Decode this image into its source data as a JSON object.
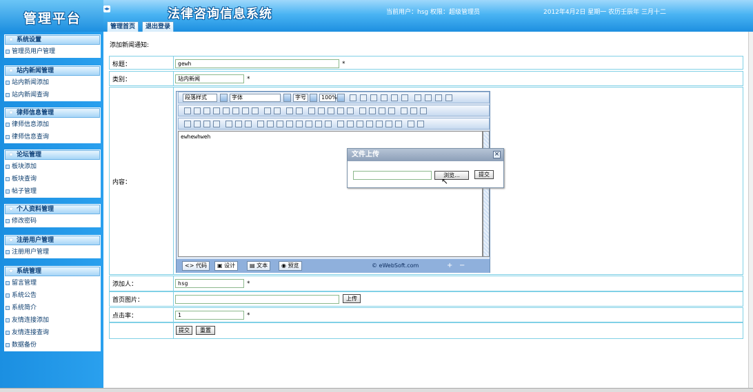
{
  "header": {
    "logo": "管理平台",
    "system_title": "法律咨询信息系统",
    "user_info": "当前用户：hsg 权限：超级管理员",
    "date_info": "2012年4月2日 星期一 农历壬辰年 三月十二",
    "toggle": "◂▸",
    "tabs": [
      {
        "label": "管理首页"
      },
      {
        "label": "退出登录"
      }
    ]
  },
  "sidebar": {
    "groups": [
      {
        "title": "系统设置",
        "items": [
          "管理员用户管理"
        ]
      },
      {
        "title": "站内新闻管理",
        "items": [
          "站内新闻添加",
          "站内新闻查询"
        ]
      },
      {
        "title": "律师信息管理",
        "items": [
          "律师信息添加",
          "律师信息查询"
        ]
      },
      {
        "title": "论坛管理",
        "items": [
          "板块添加",
          "板块查询",
          "帖子管理"
        ]
      },
      {
        "title": "个人资料管理",
        "items": [
          "修改密码"
        ]
      },
      {
        "title": "注册用户管理",
        "items": [
          "注册用户管理"
        ]
      },
      {
        "title": "系统管理",
        "items": [
          "留言管理",
          "系统公告",
          "系统简介",
          "友情连接添加",
          "友情连接查询",
          "数据备份"
        ]
      }
    ]
  },
  "form": {
    "notice": "添加新闻通知:",
    "title_label": "标题：",
    "title_value": "gewh",
    "category_label": "类别：",
    "category_value": "站内新闻",
    "content_label": "内容：",
    "adder_label": "添加人：",
    "adder_value": "hsg",
    "image_label": "首页图片：",
    "image_value": "",
    "upload_button": "上传",
    "clicks_label": "点击率：",
    "clicks_value": "1",
    "required_mark": "*",
    "submit_button": "提交",
    "reset_button": "重置"
  },
  "editor": {
    "paragraph_style": "段落样式",
    "font": "字体",
    "font_size": "字号",
    "zoom": "100%",
    "content": "ewhewhweh",
    "tab_code": "代码",
    "tab_design": "设计",
    "tab_text": "文本",
    "tab_preview": "预览",
    "copyright": "© eWebSoft.com"
  },
  "upload_dialog": {
    "title": "文件上传",
    "close": "×",
    "file_value": "",
    "browse_button": "浏览...",
    "submit_button": "提交"
  }
}
